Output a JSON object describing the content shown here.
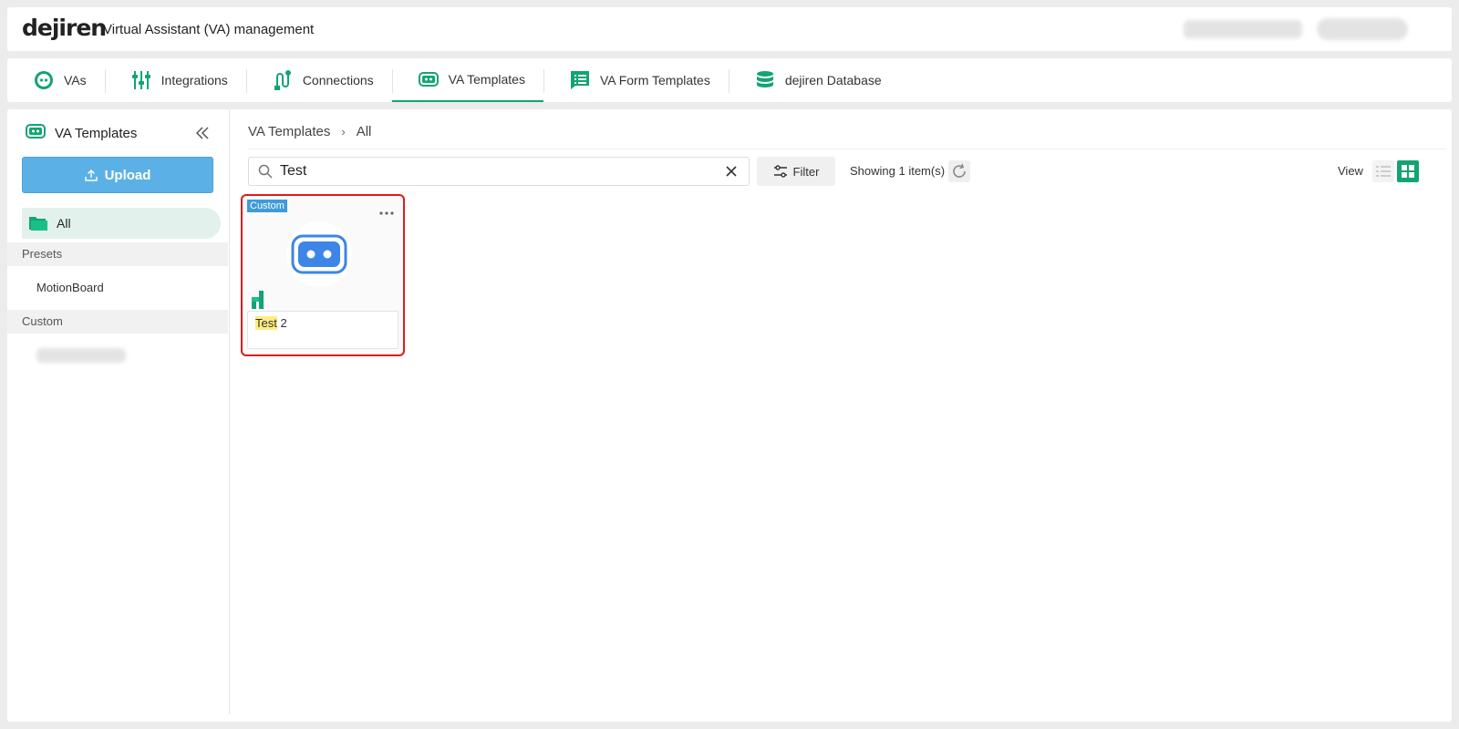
{
  "header": {
    "logo": "dejiren",
    "title": "Virtual Assistant (VA) management"
  },
  "nav": {
    "tabs": [
      {
        "label": "VAs",
        "icon": "robot-face-icon"
      },
      {
        "label": "Integrations",
        "icon": "integrations-icon"
      },
      {
        "label": "Connections",
        "icon": "connections-icon"
      },
      {
        "label": "VA Templates",
        "icon": "va-template-icon",
        "active": true
      },
      {
        "label": "VA Form Templates",
        "icon": "form-template-icon"
      },
      {
        "label": "dejiren Database",
        "icon": "database-icon"
      }
    ]
  },
  "sidebar": {
    "title": "VA Templates",
    "upload_label": "Upload",
    "all_label": "All",
    "presets_label": "Presets",
    "presets_items": [
      "MotionBoard"
    ],
    "custom_label": "Custom"
  },
  "breadcrumb": {
    "root": "VA Templates",
    "current": "All"
  },
  "search": {
    "value": "Test",
    "placeholder": ""
  },
  "toolbar": {
    "filter_label": "Filter",
    "showing_text": "Showing 1 item(s)",
    "view_label": "View"
  },
  "cards": [
    {
      "badge": "Custom",
      "name_highlight": "Test",
      "name_rest": " 2"
    }
  ],
  "colors": {
    "accent": "#12a474",
    "upload": "#5bb1e6",
    "badge": "#3f9bd9",
    "selection": "#e0191b",
    "highlight": "#ffec80"
  }
}
